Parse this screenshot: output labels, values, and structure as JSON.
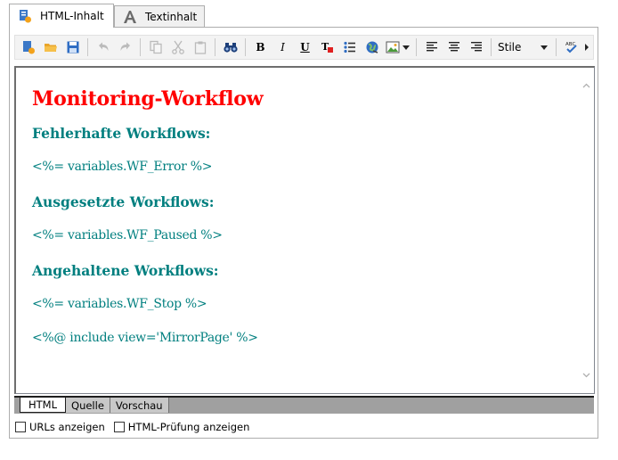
{
  "tabs": [
    {
      "label": "HTML-Inhalt",
      "icon": "html-content-icon",
      "active": true
    },
    {
      "label": "Textinhalt",
      "icon": "text-a-icon",
      "active": false
    }
  ],
  "toolbar": {
    "style_label": "Stile"
  },
  "document": {
    "title": "Monitoring-Workflow",
    "section1_heading": "Fehlerhafte Workflows:",
    "section1_value": "<%= variables.WF_Error %>",
    "section2_heading": "Ausgesetzte Workflows:",
    "section2_value": "<%= variables.WF_Paused %>",
    "section3_heading": "Angehaltene Workflows:",
    "section3_value": "<%= variables.WF_Stop %>",
    "include_line": "<%@ include view='MirrorPage' %>"
  },
  "mode_tabs": [
    {
      "label": "HTML",
      "active": true
    },
    {
      "label": "Quelle",
      "active": false
    },
    {
      "label": "Vorschau",
      "active": false
    }
  ],
  "options": {
    "show_urls_label": "URLs anzeigen",
    "html_check_label": "HTML-Prüfung anzeigen"
  },
  "colors": {
    "title_red": "#ff0000",
    "teal_text": "#007f7f"
  }
}
